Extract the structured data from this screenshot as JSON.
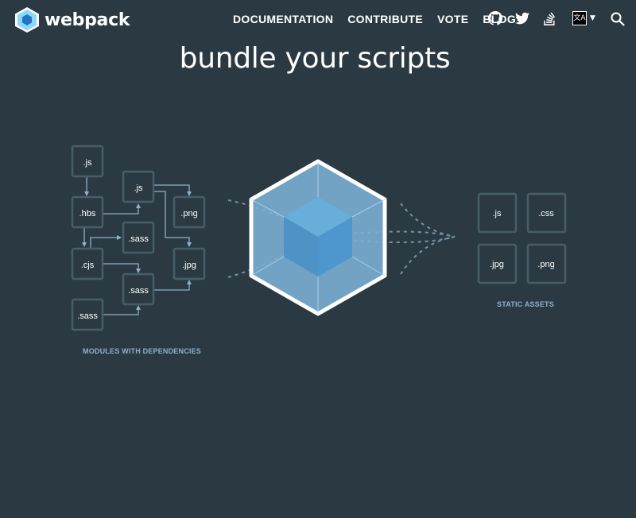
{
  "header": {
    "logo_text": "webpack",
    "nav": [
      {
        "label": "DOCUMENTATION"
      },
      {
        "label": "CONTRIBUTE"
      },
      {
        "label": "VOTE"
      },
      {
        "label": "BLOG"
      }
    ],
    "icons": [
      "github-icon",
      "twitter-icon",
      "stack-overflow-icon",
      "language-icon",
      "search-icon"
    ]
  },
  "headline": "bundle your scripts",
  "diagram": {
    "modules": [
      {
        "label": ".js"
      },
      {
        "label": ".js"
      },
      {
        "label": ".hbs"
      },
      {
        "label": ".png"
      },
      {
        "label": ".sass"
      },
      {
        "label": ".cjs"
      },
      {
        "label": ".jpg"
      },
      {
        "label": ".sass"
      },
      {
        "label": ".sass"
      }
    ],
    "modules_caption": "MODULES WITH DEPENDENCIES",
    "assets": [
      {
        "label": ".js"
      },
      {
        "label": ".css"
      },
      {
        "label": ".jpg"
      },
      {
        "label": ".png"
      }
    ],
    "assets_caption": "STATIC ASSETS"
  },
  "colors": {
    "background": "#2b3a42",
    "box_border": "#465e69",
    "arrow": "#8eb1c7",
    "cube_light": "#8ed6fb",
    "cube_dark": "#1c78c0"
  }
}
